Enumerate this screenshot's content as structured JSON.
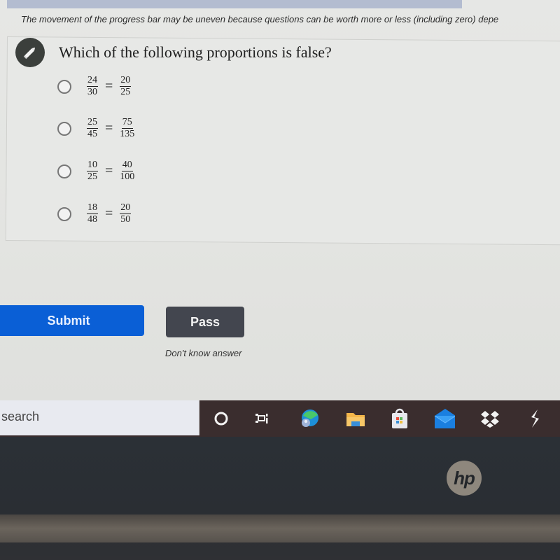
{
  "quiz": {
    "progress_notice": "The movement of the progress bar may be uneven because questions can be worth more or less (including zero) depe",
    "question": "Which of the following proportions is false?",
    "options": [
      {
        "left_num": "24",
        "left_den": "30",
        "right_num": "20",
        "right_den": "25",
        "selected": false
      },
      {
        "left_num": "25",
        "left_den": "45",
        "right_num": "75",
        "right_den": "135",
        "selected": false
      },
      {
        "left_num": "10",
        "left_den": "25",
        "right_num": "40",
        "right_den": "100",
        "selected": false
      },
      {
        "left_num": "18",
        "left_den": "48",
        "right_num": "20",
        "right_den": "50",
        "selected": false
      }
    ],
    "equals": "=",
    "submit_label": "Submit",
    "pass_label": "Pass",
    "pass_hint": "Don't know answer"
  },
  "taskbar": {
    "search_text": "search",
    "icons": [
      "cortana-icon",
      "task-view-icon",
      "edge-icon",
      "file-explorer-icon",
      "store-icon",
      "mail-icon",
      "dropbox-icon",
      "app-icon"
    ]
  },
  "device": {
    "logo_text": "hp"
  },
  "colors": {
    "submit": "#0a5fd6",
    "pass": "#43464f",
    "taskbar": "#3a2d2e"
  }
}
